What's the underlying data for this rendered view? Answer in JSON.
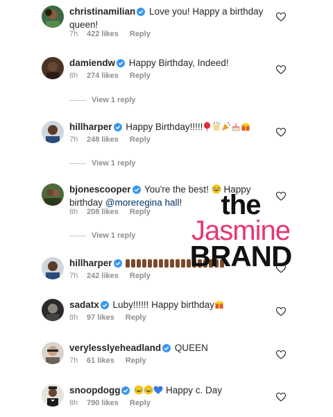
{
  "comments": [
    {
      "user": "christinamilian",
      "text": "Love you! Happy a birthday queen!",
      "time": "7h",
      "likes": "422 likes",
      "reply": "Reply",
      "avatar_color": "#3a6a45"
    },
    {
      "user": "damiendw",
      "text": "Happy Birthday, Indeed!",
      "time": "8h",
      "likes": "274 likes",
      "reply": "Reply",
      "avatar_color": "#4a3426",
      "view_replies": "View 1 reply"
    },
    {
      "user": "hillharper",
      "text": "Happy Birthday!!!!!",
      "time": "7h",
      "likes": "248 likes",
      "reply": "Reply",
      "avatar_color": "#3b3b40",
      "view_replies": "View 1 reply"
    },
    {
      "user": "bjonescooper",
      "text_prefix": "You're the best! ",
      "text_mid": " Happy birthday ",
      "mention": "@moreregina hall",
      "text_suffix": "!",
      "time": "8h",
      "likes": "208 likes",
      "reply": "Reply",
      "avatar_color": "#4f6a3a",
      "view_replies": "View 1 reply"
    },
    {
      "user": "hillharper",
      "text": "",
      "time": "7h",
      "likes": "242 likes",
      "reply": "Reply",
      "avatar_color": "#3b3b40"
    },
    {
      "user": "sadatx",
      "text": "Luby!!!!!! Happy birthday",
      "time": "8h",
      "likes": "97 likes",
      "reply": "Reply",
      "avatar_color": "#2a2a2a"
    },
    {
      "user": "verylesslyeheadland",
      "text": "QUEEN",
      "time": "7h",
      "likes": "61 likes",
      "reply": "Reply",
      "avatar_color": "#6b6258"
    },
    {
      "user": "snoopdogg",
      "text": "Happy c. Day",
      "time": "8h",
      "likes": "790 likes",
      "reply": "Reply",
      "avatar_color": "#5a4a3f"
    }
  ],
  "watermark": {
    "line1": "the",
    "line2": "Jasmine",
    "line3": "BRAND"
  },
  "colors": {
    "verified": "#3897f0",
    "meta": "#8e8e8e",
    "watermark_pink": "#e8356f",
    "mention": "#003569"
  },
  "icons": {
    "verified": "verified-badge-icon",
    "like": "heart-outline-icon"
  }
}
